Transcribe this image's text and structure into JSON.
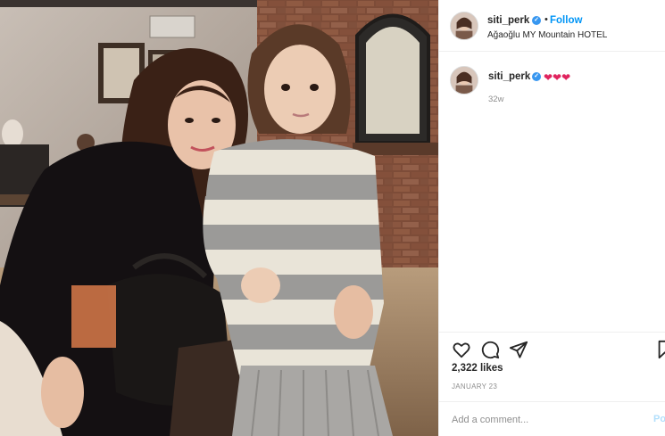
{
  "post": {
    "username": "siti_perk",
    "follow_label": "Follow",
    "separator": "•",
    "location": "Ağaoğlu MY Mountain HOTEL",
    "avatar_icon": "profile-avatar-icon",
    "verified_icon": "verified-badge-icon"
  },
  "caption": {
    "username": "siti_perk",
    "text": "❤❤❤",
    "time_ago": "32w"
  },
  "actions": {
    "like_icon": "heart-outline-icon",
    "comment_icon": "comment-bubble-icon",
    "share_icon": "paper-plane-icon",
    "save_icon": "bookmark-icon"
  },
  "stats": {
    "likes": "2,322 likes",
    "date": "JANUARY 23"
  },
  "comment_box": {
    "placeholder": "Add a comment...",
    "post_label": "Po"
  },
  "colors": {
    "link_blue": "#0095f6",
    "verified_blue": "#3897f0",
    "muted_text": "#8e8e8e",
    "heart_red": "#e0245e",
    "border": "#efefef"
  }
}
